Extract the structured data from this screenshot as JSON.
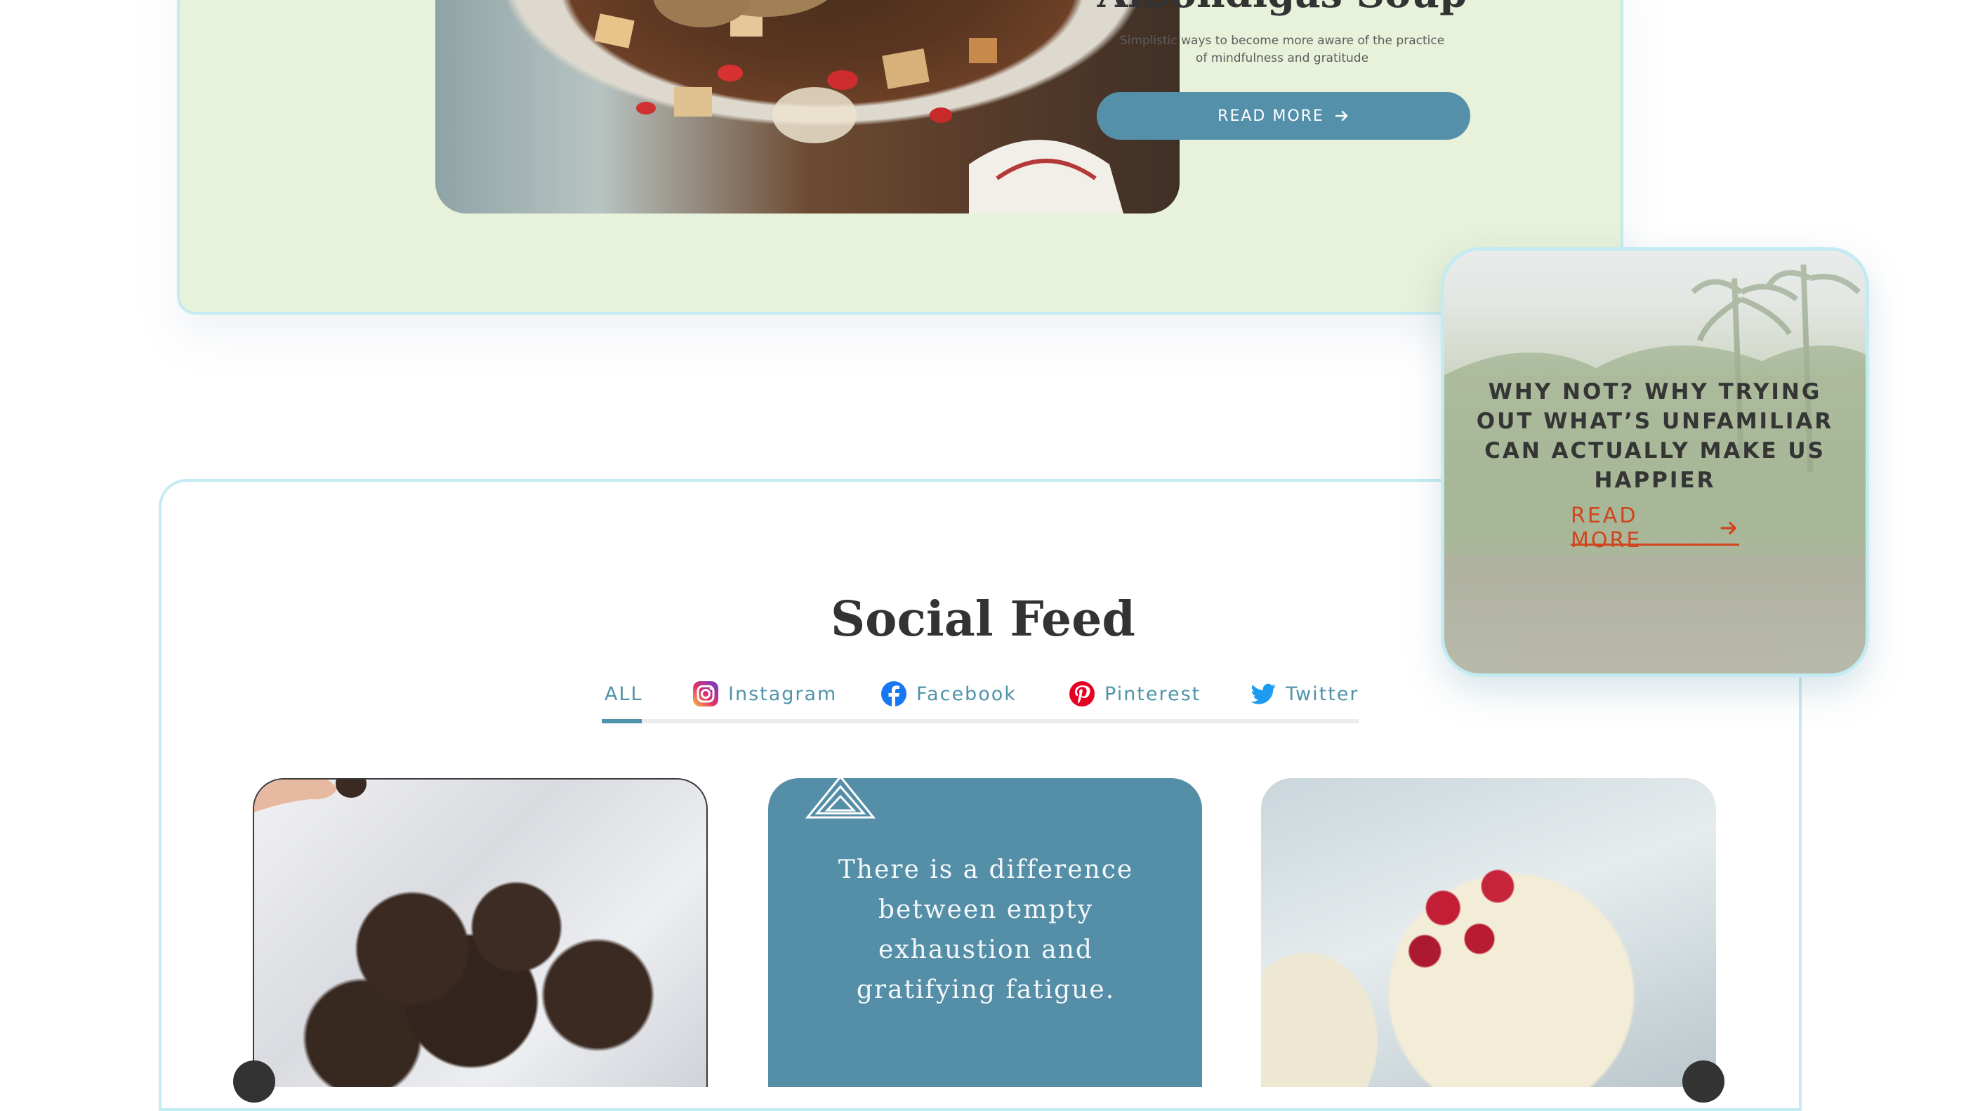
{
  "hero": {
    "title": "Albondigas Soup",
    "subtitle": "Simplistic ways to become more aware of the practice of mindfulness and gratitude",
    "button_label": "READ MORE"
  },
  "featured": {
    "title": "WHY NOT? WHY TRYING OUT WHAT’S UNFAMILIAR CAN ACTUALLY MAKE US HAPPIER",
    "link_label": "READ MORE"
  },
  "social_feed": {
    "title": "Social Feed",
    "tabs": [
      {
        "label": "ALL",
        "icon": "none",
        "active": true
      },
      {
        "label": "Instagram",
        "icon": "instagram-icon",
        "active": false
      },
      {
        "label": "Facebook",
        "icon": "facebook-icon",
        "active": false
      },
      {
        "label": "Pinterest",
        "icon": "pinterest-icon",
        "active": false
      },
      {
        "label": "Twitter",
        "icon": "twitter-icon",
        "active": false
      }
    ],
    "posts": [
      {
        "type": "image",
        "alt": ""
      },
      {
        "type": "quote",
        "text": "There is a difference between empty exhaustion and gratifying fatigue."
      },
      {
        "type": "image",
        "alt": ""
      }
    ]
  },
  "colors": {
    "accent": "#5590aa",
    "hero_bg": "#e8f1d9",
    "border": "#c3ebf1",
    "link_red": "#d0451b",
    "text_dark": "#333333"
  }
}
